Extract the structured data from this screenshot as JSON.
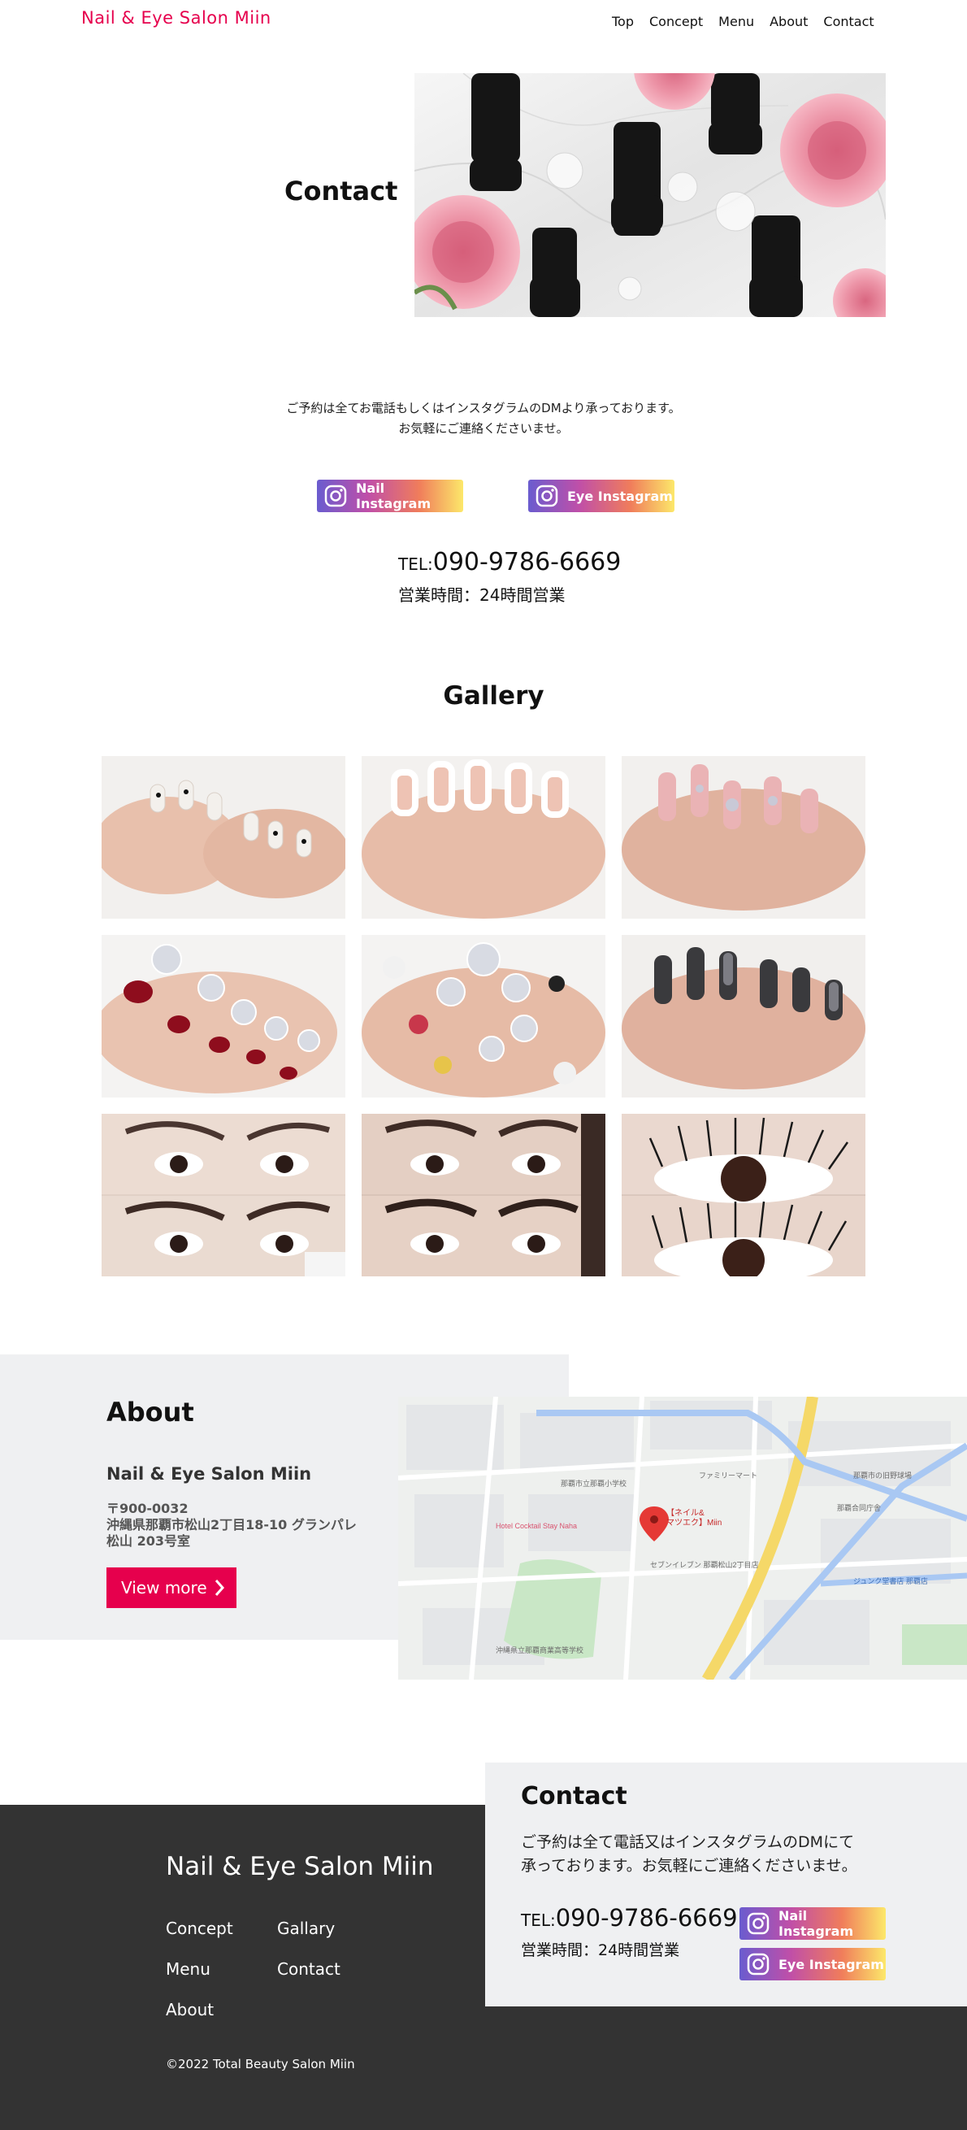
{
  "header": {
    "brand": "Nail & Eye Salon Miin",
    "nav": [
      "Top",
      "Concept",
      "Menu",
      "About",
      "Contact"
    ]
  },
  "hero": {
    "title": "Contact",
    "image": "nail-polish-and-roses-photo"
  },
  "intro": {
    "line1": "ご予約は全てお電話もしくはインスタグラムのDMより承っております。",
    "line2": "お気軽にご連絡くださいませ。"
  },
  "instagram": {
    "nail_label": "Nail Instagram",
    "eye_label": "Eye Instagram",
    "icon": "instagram-icon"
  },
  "contact_info": {
    "tel_prefix": "TEL:",
    "tel": "090-9786-6669",
    "hours": "営業時間：24時間営業"
  },
  "gallery": {
    "title": "Gallery",
    "images": [
      "white-gradient-nails-with-black-hearts",
      "french-tip-nails",
      "pink-nails-with-rhinestones",
      "red-pedicure",
      "decorated-pedicure",
      "black-glitter-nails",
      "eyebrow-before-after",
      "eyebrow-before-after-2",
      "eyelash-perm-before-after"
    ]
  },
  "about": {
    "title": "About",
    "name": "Nail & Eye Salon Miin",
    "postal": "〒900-0032",
    "address": "沖縄県那覇市松山2丁目18-10 グランパレ松山 203号室",
    "button": "View more"
  },
  "map": {
    "pin_label_line1": "【ネイル&",
    "pin_label_line2": "マツエク】Miin",
    "labels": [
      "那覇市立那覇小学校",
      "セブンイレブン 那覇松山2丁目店",
      "ファミリーマート",
      "Hotel Cocktail Stay Naha",
      "沖縄県立那覇商業高等学校",
      "那覇合同庁舎",
      "ジュンク堂書店 那覇店",
      "那覇市の旧野球場"
    ]
  },
  "footer": {
    "brand": "Nail & Eye Salon Miin",
    "links": [
      "Concept",
      "Gallary",
      "Menu",
      "Contact",
      "About"
    ],
    "copyright": "©2022 Total Beauty Salon Miin"
  },
  "contact_card": {
    "title": "Contact",
    "text_line1": "ご予約は全て電話又はインスタグラムのDMにて",
    "text_line2": "承っております。お気軽にご連絡くださいませ。",
    "tel_prefix": "TEL:",
    "tel": "090-9786-6669",
    "hours": "営業時間：24時間営業",
    "nail_label": "Nail Instagram",
    "eye_label": "Eye Instagram"
  },
  "colors": {
    "accent": "#e6004d",
    "footer_bg": "#333333",
    "panel_bg": "#eff0f2"
  }
}
